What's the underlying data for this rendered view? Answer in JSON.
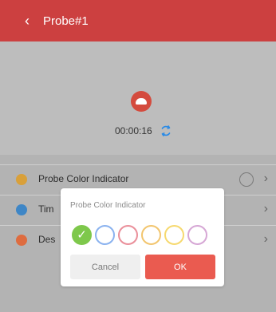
{
  "header": {
    "back_icon": "chevron-left-icon",
    "title": "Probe#1"
  },
  "probe": {
    "icon": "probe-icon",
    "timer": "00:00:16",
    "refresh_icon": "refresh-icon"
  },
  "settings": [
    {
      "label": "Probe Color Indicator",
      "dot_color": "#d9a03a",
      "trailing_icon": "circle-outline"
    },
    {
      "label": "Tim",
      "dot_color": "#3e86c6"
    },
    {
      "label": "Des",
      "dot_color": "#de6c3f"
    }
  ],
  "dialog": {
    "title": "Probe Color Indicator",
    "colors": [
      "#7ec84b",
      "#8ab2ef",
      "#ea8f9a",
      "#f2c56e",
      "#f6d96f",
      "#d6a7d5"
    ],
    "selected_index": 0,
    "cancel_label": "Cancel",
    "ok_label": "OK"
  },
  "theme": {
    "accent": "#cc4040",
    "ok": "#ea5b50",
    "overlay": "#b8b8b8"
  }
}
